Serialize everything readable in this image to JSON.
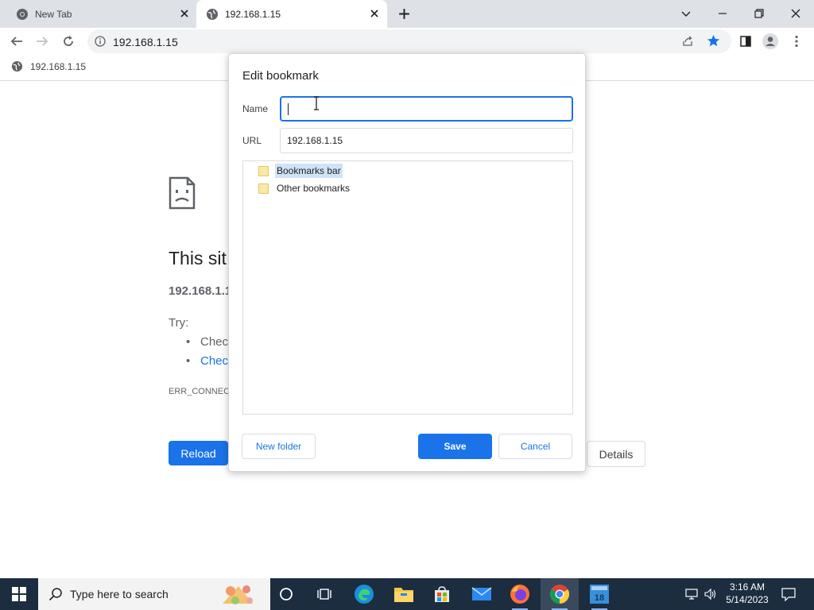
{
  "tabs": [
    {
      "title": "New Tab",
      "active": false
    },
    {
      "title": "192.168.1.15",
      "active": true
    }
  ],
  "toolbar": {
    "address": "192.168.1.15"
  },
  "bookmarks_bar": {
    "items": [
      {
        "label": "192.168.1.15"
      }
    ]
  },
  "error_page": {
    "title": "This sit",
    "host": "192.168.1.1",
    "try_label": "Try:",
    "suggestions": [
      {
        "text": "Check",
        "link": false
      },
      {
        "text": "Check",
        "link": true
      }
    ],
    "error_code": "ERR_CONNECT",
    "reload_label": "Reload",
    "details_label": "Details"
  },
  "dialog": {
    "title": "Edit bookmark",
    "name_label": "Name",
    "name_value": "",
    "url_label": "URL",
    "url_value": "192.168.1.15",
    "folders": [
      {
        "label": "Bookmarks bar",
        "selected": true
      },
      {
        "label": "Other bookmarks",
        "selected": false
      }
    ],
    "new_folder_label": "New folder",
    "save_label": "Save",
    "cancel_label": "Cancel"
  },
  "taskbar": {
    "search_placeholder": "Type here to search",
    "time": "3:16 AM",
    "date": "5/14/2023",
    "badge": "18"
  },
  "colors": {
    "accent": "#1a73e8",
    "tabstrip": "#dee1e6",
    "taskbar": "#1c2d40",
    "selection": "#cfe2f7"
  }
}
